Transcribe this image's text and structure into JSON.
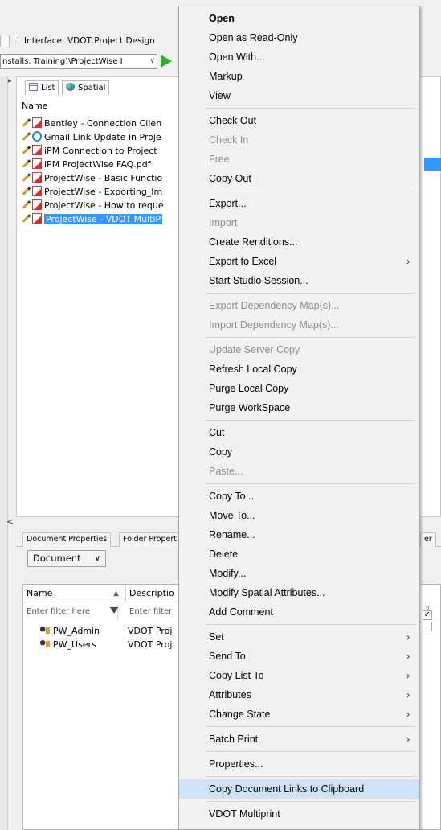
{
  "toolbar": {
    "interface_label": "Interface",
    "interface_value": "VDOT Project Design",
    "path_value": "nstalls, Training)\\ProjectWise I"
  },
  "list_pane": {
    "tabs": [
      {
        "label": "List"
      },
      {
        "label": "Spatial"
      }
    ],
    "column_header": "Name",
    "documents": [
      {
        "name": "Bentley - Connection Clien"
      },
      {
        "name": "Gmail Link Update in Proje"
      },
      {
        "name": "iPM Connection to Project"
      },
      {
        "name": "iPM ProjectWise FAQ.pdf"
      },
      {
        "name": "ProjectWise - Basic Functio"
      },
      {
        "name": "ProjectWise - Exporting_Im"
      },
      {
        "name": "ProjectWise - How to reque"
      },
      {
        "name": "ProjectWise - VDOT MultiP"
      }
    ]
  },
  "properties_pane": {
    "tabs": [
      {
        "label": "Document Properties"
      },
      {
        "label": "Folder Propert"
      },
      {
        "label": "er"
      }
    ],
    "type_selector": "Document",
    "columns": [
      {
        "label": "Name"
      },
      {
        "label": "Descriptio"
      }
    ],
    "filter_placeholders": [
      "Enter filter here",
      "Enter filter"
    ],
    "rows": [
      {
        "name": "PW_Admin",
        "description": "VDOT Proj"
      },
      {
        "name": "PW_Users",
        "description": "VDOT Proj"
      }
    ]
  },
  "context_menu": {
    "items": [
      {
        "label": "Open",
        "bold": true
      },
      {
        "label": "Open as Read-Only"
      },
      {
        "label": "Open With..."
      },
      {
        "label": "Markup"
      },
      {
        "label": "View"
      },
      {
        "sep": true
      },
      {
        "label": "Check Out"
      },
      {
        "label": "Check In",
        "disabled": true
      },
      {
        "label": "Free",
        "disabled": true
      },
      {
        "label": "Copy Out"
      },
      {
        "sep": true
      },
      {
        "label": "Export..."
      },
      {
        "label": "Import",
        "disabled": true
      },
      {
        "label": "Create Renditions..."
      },
      {
        "label": "Export to Excel",
        "submenu": true
      },
      {
        "label": "Start Studio Session..."
      },
      {
        "sep": true
      },
      {
        "label": "Export Dependency Map(s)...",
        "disabled": true
      },
      {
        "label": "Import Dependency Map(s)...",
        "disabled": true
      },
      {
        "sep": true
      },
      {
        "label": "Update Server Copy",
        "disabled": true
      },
      {
        "label": "Refresh Local Copy"
      },
      {
        "label": "Purge Local Copy"
      },
      {
        "label": "Purge WorkSpace"
      },
      {
        "sep": true
      },
      {
        "label": "Cut"
      },
      {
        "label": "Copy"
      },
      {
        "label": "Paste...",
        "disabled": true
      },
      {
        "sep": true
      },
      {
        "label": "Copy To..."
      },
      {
        "label": "Move To..."
      },
      {
        "label": "Rename..."
      },
      {
        "label": "Delete"
      },
      {
        "label": "Modify..."
      },
      {
        "label": "Modify Spatial Attributes..."
      },
      {
        "label": "Add Comment"
      },
      {
        "sep": true
      },
      {
        "label": "Set",
        "submenu": true
      },
      {
        "label": "Send To",
        "submenu": true
      },
      {
        "label": "Copy List To",
        "submenu": true
      },
      {
        "label": "Attributes",
        "submenu": true
      },
      {
        "label": "Change State",
        "submenu": true
      },
      {
        "sep": true
      },
      {
        "label": "Batch Print",
        "submenu": true
      },
      {
        "sep": true
      },
      {
        "label": "Properties..."
      },
      {
        "sep": true
      },
      {
        "label": "Copy Document Links to Clipboard",
        "highlighted": true
      },
      {
        "sep": true
      },
      {
        "label": "VDOT Multiprint"
      }
    ]
  },
  "icons": {
    "submenu_arrow": "chevron-right-icon",
    "selection_color": "#3399ff",
    "highlight_color": "#cfe3f8"
  }
}
